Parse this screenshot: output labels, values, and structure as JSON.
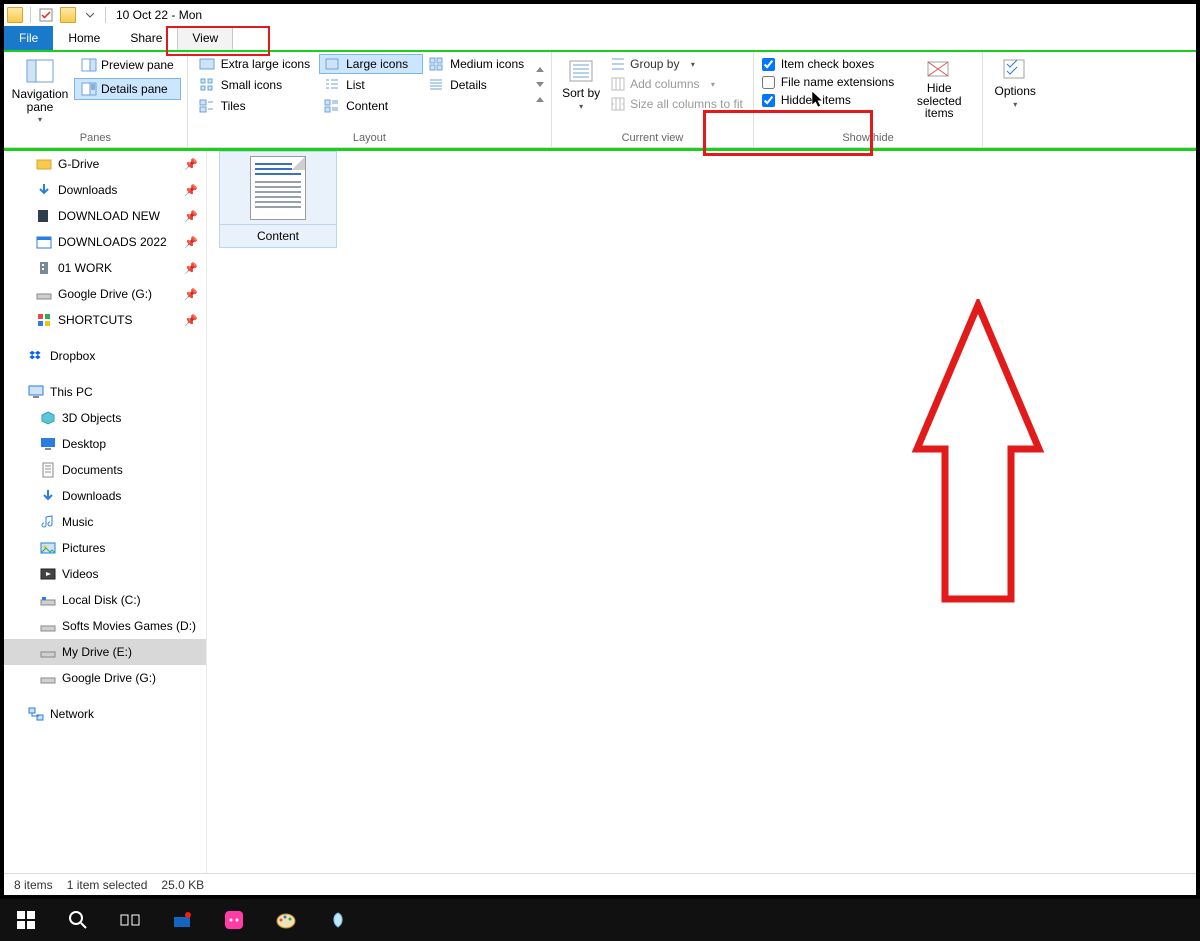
{
  "title": "10 Oct 22 - Mon",
  "tabs": {
    "file": "File",
    "home": "Home",
    "share": "Share",
    "view": "View"
  },
  "ribbon": {
    "panes": {
      "nav": "Navigation pane",
      "preview": "Preview pane",
      "details": "Details pane",
      "label": "Panes"
    },
    "layout": {
      "xl": "Extra large icons",
      "lg": "Large icons",
      "md": "Medium icons",
      "sm": "Small icons",
      "list": "List",
      "details": "Details",
      "tiles": "Tiles",
      "content": "Content",
      "label": "Layout"
    },
    "currentview": {
      "sort": "Sort by",
      "group": "Group by",
      "addcols": "Add columns",
      "sizecols": "Size all columns to fit",
      "label": "Current view"
    },
    "showhide": {
      "itemcb": "Item check boxes",
      "ext": "File name extensions",
      "hidden": "Hidden items",
      "hidesel": "Hide selected items",
      "label": "Show/hide"
    },
    "options": "Options"
  },
  "nav": {
    "qa": [
      {
        "label": "G-Drive",
        "pin": true
      },
      {
        "label": "Downloads",
        "pin": true
      },
      {
        "label": "DOWNLOAD NEW",
        "pin": true
      },
      {
        "label": "DOWNLOADS 2022",
        "pin": true
      },
      {
        "label": "01 WORK",
        "pin": true
      },
      {
        "label": "Google Drive (G:)",
        "pin": true
      },
      {
        "label": "SHORTCUTS",
        "pin": true
      }
    ],
    "dropbox": "Dropbox",
    "thispc": "This PC",
    "pc": [
      "3D Objects",
      "Desktop",
      "Documents",
      "Downloads",
      "Music",
      "Pictures",
      "Videos",
      "Local Disk (C:)",
      "Softs Movies Games (D:)",
      "My Drive (E:)",
      "Google Drive (G:)"
    ],
    "network": "Network"
  },
  "content_item": "Content",
  "status": {
    "items": "8 items",
    "selected": "1 item selected",
    "size": "25.0 KB"
  }
}
